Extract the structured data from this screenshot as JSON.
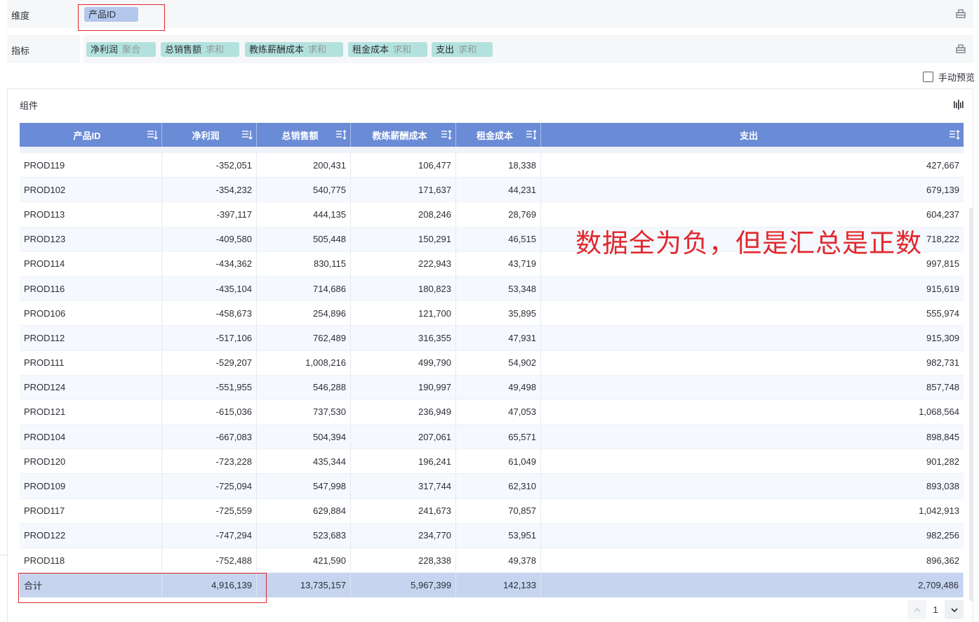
{
  "dimension_shelf": {
    "label": "维度",
    "pills": [
      {
        "name": "产品ID"
      }
    ]
  },
  "metric_shelf": {
    "label": "指标",
    "pills": [
      {
        "name": "净利润",
        "agg": "聚合"
      },
      {
        "name": "总销售额",
        "agg": "求和"
      },
      {
        "name": "教练薪酬成本",
        "agg": "求和"
      },
      {
        "name": "租金成本",
        "agg": "求和"
      },
      {
        "name": "支出",
        "agg": "求和"
      }
    ]
  },
  "preview": {
    "label": "手动预览",
    "checked": false
  },
  "panel": {
    "title": "组件"
  },
  "table": {
    "columns": [
      "产品ID",
      "净利润",
      "总销售额",
      "教练薪酬成本",
      "租金成本",
      "支出"
    ],
    "rows": [
      [
        "PROD119",
        "-352,051",
        "200,431",
        "106,477",
        "18,338",
        "427,667"
      ],
      [
        "PROD102",
        "-354,232",
        "540,775",
        "171,637",
        "44,231",
        "679,139"
      ],
      [
        "PROD113",
        "-397,117",
        "444,135",
        "208,246",
        "28,769",
        "604,237"
      ],
      [
        "PROD123",
        "-409,580",
        "505,448",
        "150,291",
        "46,515",
        "718,222"
      ],
      [
        "PROD114",
        "-434,362",
        "830,115",
        "222,943",
        "43,719",
        "997,815"
      ],
      [
        "PROD116",
        "-435,104",
        "714,686",
        "180,823",
        "53,348",
        "915,619"
      ],
      [
        "PROD106",
        "-458,673",
        "254,896",
        "121,700",
        "35,895",
        "555,974"
      ],
      [
        "PROD112",
        "-517,106",
        "762,489",
        "316,355",
        "47,931",
        "915,309"
      ],
      [
        "PROD111",
        "-529,207",
        "1,008,216",
        "499,790",
        "54,902",
        "982,731"
      ],
      [
        "PROD124",
        "-551,955",
        "546,288",
        "190,997",
        "49,498",
        "857,748"
      ],
      [
        "PROD121",
        "-615,036",
        "737,530",
        "236,949",
        "47,053",
        "1,068,564"
      ],
      [
        "PROD104",
        "-667,083",
        "504,394",
        "207,061",
        "65,571",
        "898,845"
      ],
      [
        "PROD120",
        "-723,228",
        "435,344",
        "196,241",
        "61,049",
        "901,282"
      ],
      [
        "PROD109",
        "-725,094",
        "547,998",
        "317,744",
        "62,310",
        "893,038"
      ],
      [
        "PROD117",
        "-725,559",
        "629,884",
        "241,673",
        "70,857",
        "1,042,913"
      ],
      [
        "PROD122",
        "-747,294",
        "523,683",
        "234,770",
        "53,951",
        "982,256"
      ],
      [
        "PROD118",
        "-752,488",
        "421,590",
        "228,338",
        "49,378",
        "896,362"
      ]
    ],
    "total": [
      "合计",
      "4,916,139",
      "13,735,157",
      "5,967,399",
      "142,133",
      "2,709,486"
    ]
  },
  "annotation": "数据全为负，但是汇总是正数",
  "pagination": {
    "current_page": "1"
  },
  "colors": {
    "header_bg": "#6a8bd6",
    "total_row_bg": "#c6d4ef",
    "dimension_pill": "#b4c7ec",
    "metric_pill": "#b3e2de",
    "annotation_red": "#e0282e"
  },
  "icons": {
    "shelf_action": "clear-shelf-icon",
    "sort": "sort-icon",
    "panel_action": "chart-type-icon",
    "page_prev": "chevron-up-icon",
    "page_next": "chevron-down-icon"
  }
}
